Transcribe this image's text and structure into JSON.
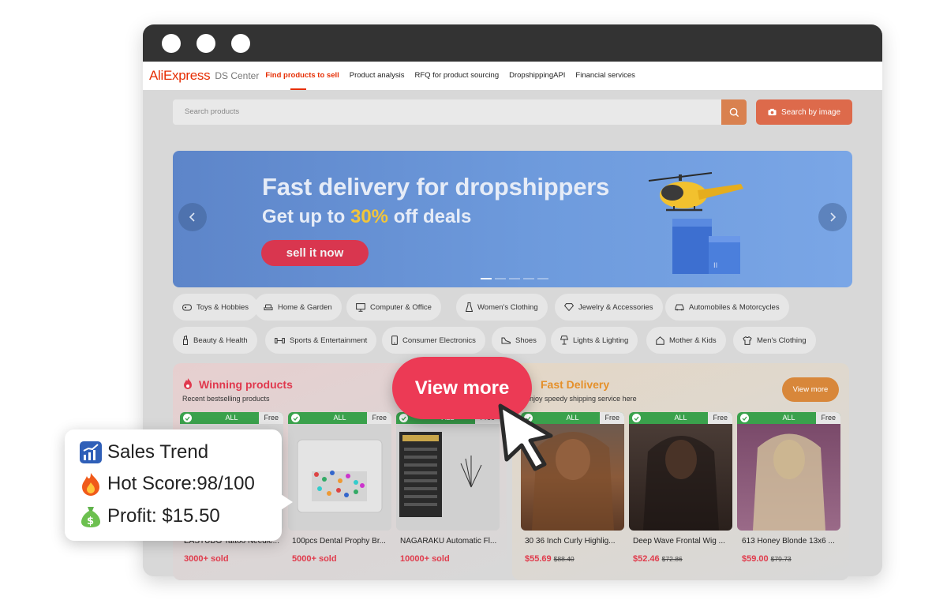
{
  "nav": {
    "logo": "AliExpress",
    "logo_sub": "DS Center",
    "items": [
      "Find products to sell",
      "Product analysis",
      "RFQ for product sourcing",
      "DropshippingAPI",
      "Financial services"
    ]
  },
  "search": {
    "placeholder": "Search products",
    "image_button": "Search by image"
  },
  "banner": {
    "title": "Fast delivery for dropshippers",
    "sub_prefix": "Get up to ",
    "sub_highlight": "30%",
    "sub_suffix": " off deals",
    "cta": "sell it now",
    "slide_count": 5,
    "active_slide": 1
  },
  "categories": [
    "Toys & Hobbies",
    "Home & Garden",
    "Computer & Office",
    "Women's Clothing",
    "Jewelry & Accessories",
    "Automobiles & Motorcycles",
    "Beauty & Health",
    "Sports & Entertainment",
    "Consumer Electronics",
    "Shoes",
    "Lights & Lighting",
    "Mother & Kids",
    "Men's Clothing"
  ],
  "winning": {
    "title": "Winning products",
    "subtitle": "Recent bestselling products",
    "tag_all": "ALL",
    "tag_free": "Free",
    "products": [
      {
        "name": "EASTUDG Tattoo Needle...",
        "sold": "3000+ sold"
      },
      {
        "name": "100pcs Dental Prophy Br...",
        "sold": "5000+ sold"
      },
      {
        "name": "NAGARAKU Automatic Fl...",
        "sold": "10000+ sold"
      }
    ]
  },
  "fast": {
    "title": "Fast Delivery",
    "subtitle": "Enjoy speedy shipping service here",
    "view_more": "View more",
    "products": [
      {
        "name": "30 36 Inch Curly Highlig...",
        "price": "$55.69",
        "original": "$88.40"
      },
      {
        "name": "Deep Wave Frontal Wig ...",
        "price": "$52.46",
        "original": "$72.86"
      },
      {
        "name": "613 Honey Blonde 13x6 ...",
        "price": "$59.00",
        "original": "$79.73"
      }
    ]
  },
  "overlay": {
    "view_more": "View more",
    "sales_trend": "Sales Trend",
    "hot_score": "Hot Score:98/100",
    "profit": "Profit: $15.50"
  },
  "colors": {
    "accent": "#e62e04",
    "cta": "#ec3a55",
    "green_tag": "#3aa14c",
    "banner": "#6e9bdd"
  }
}
